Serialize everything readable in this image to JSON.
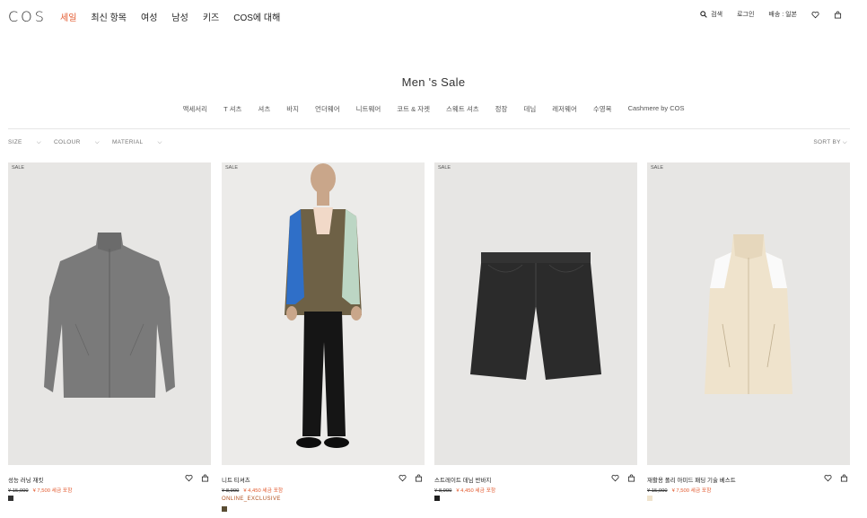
{
  "brand": "COS",
  "nav": [
    {
      "label": "세일",
      "active": true
    },
    {
      "label": "최신 항목",
      "active": false
    },
    {
      "label": "여성",
      "active": false
    },
    {
      "label": "남성",
      "active": false
    },
    {
      "label": "키즈",
      "active": false
    },
    {
      "label": "COS에 대해",
      "active": false
    }
  ],
  "util": {
    "search": "검색",
    "login": "로그인",
    "shipping": "배송 : 일본",
    "wishlist_icon": "heart-icon",
    "bag_icon": "bag-icon"
  },
  "page_title": "Men 's Sale",
  "categories": [
    "액세서리",
    "T 셔츠",
    "셔츠",
    "바지",
    "언더웨어",
    "니트웨어",
    "코트 & 자켓",
    "스웨트 셔츠",
    "정장",
    "데님",
    "레저웨어",
    "수영복",
    "Cashmere by COS"
  ],
  "filters": [
    "SIZE",
    "COLOUR",
    "MATERIAL"
  ],
  "sort_label": "SORT BY",
  "products": [
    {
      "badge": "SALE",
      "name": "성능 러닝 재킷",
      "old_price": "¥ 15,000",
      "new_price": "¥ 7,500 세금 포함",
      "exclusive": "",
      "swatch": "#333333"
    },
    {
      "badge": "SALE",
      "name": "니트 티셔츠",
      "old_price": "¥ 8,900",
      "new_price": "¥ 4,450 세금 포함",
      "exclusive": "ONLINE_EXCLUSIVE",
      "swatch": "#5a4d33"
    },
    {
      "badge": "SALE",
      "name": "스트레이트 데님 반바지",
      "old_price": "¥ 8,900",
      "new_price": "¥ 4,450 세금 포함",
      "exclusive": "",
      "swatch": "#1f1f1f"
    },
    {
      "badge": "SALE",
      "name": "재활용 폴리 아미드 패딩 기술 베스트",
      "old_price": "¥ 15,000",
      "new_price": "¥ 7,500 세금 포함",
      "exclusive": "",
      "swatch": "#efe3cc"
    }
  ],
  "colors": {
    "accent": "#e2572b",
    "exclusive": "#b0501f"
  }
}
